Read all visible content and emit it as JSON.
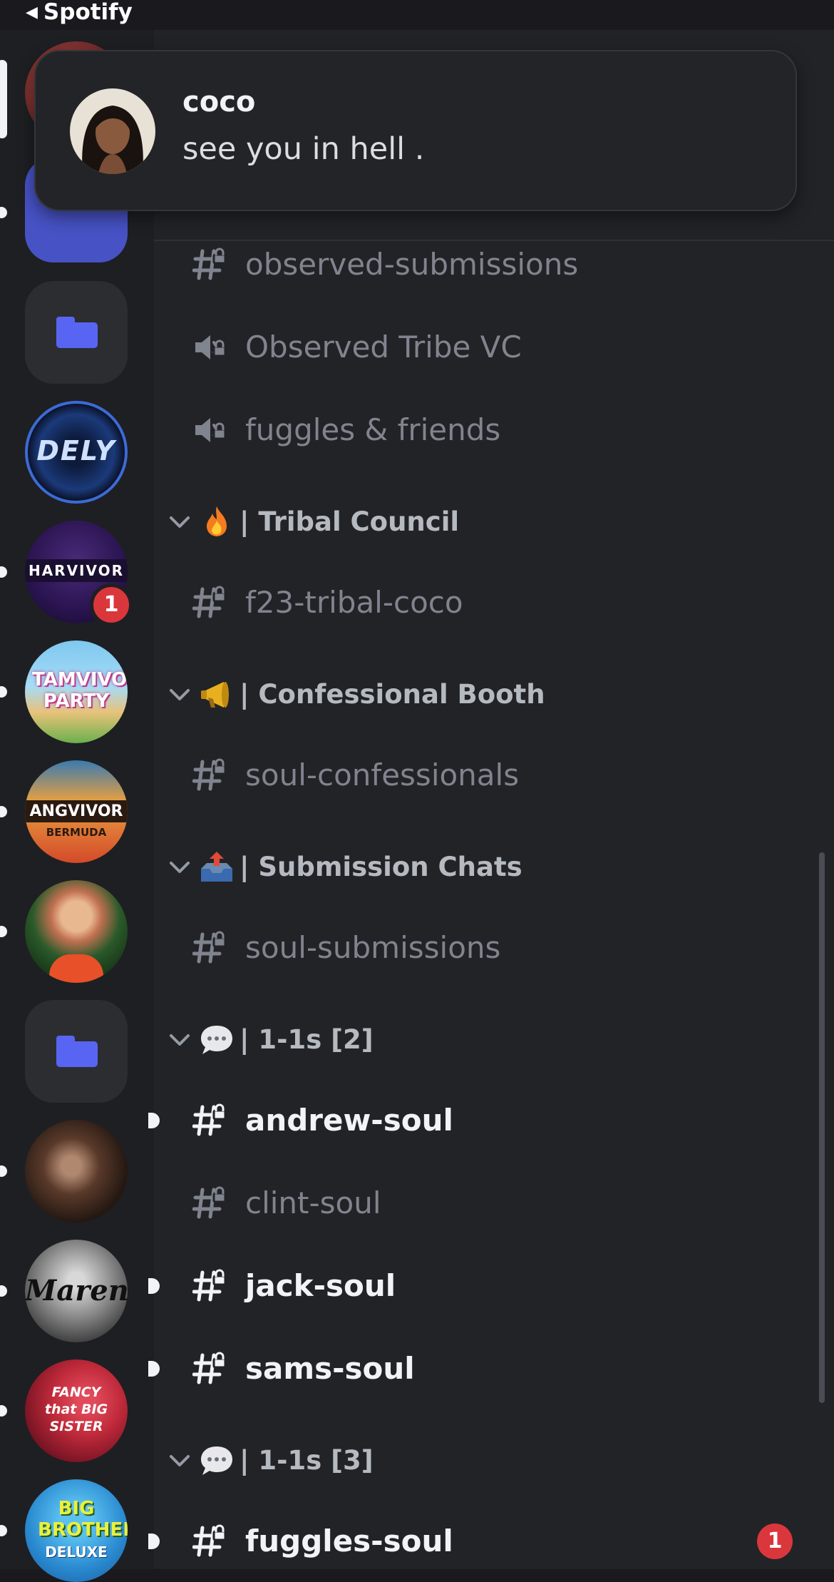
{
  "status_bar": {
    "back_label": "Spotify"
  },
  "notification": {
    "author": "coco",
    "message": "see you in hell ."
  },
  "servers": [
    {
      "label": "DELY"
    },
    {
      "label": "HARVIVOR",
      "badge": "1"
    },
    {
      "label": "TAMVIVOR PARTY"
    },
    {
      "label": "ANGVIVOR",
      "sublabel": "BERMUDA"
    },
    {
      "label": ""
    },
    {
      "label": ""
    },
    {
      "label": "Maren"
    },
    {
      "label": "FANCY that BIG SISTER"
    },
    {
      "label": "BIG BROTHER",
      "sublabel": "DELUXE"
    }
  ],
  "channels": {
    "observed_submissions": "observed-submissions",
    "observed_tribe_vc": "Observed Tribe VC",
    "fuggles_friends": "fuggles & friends",
    "tribal_council_category": "| Tribal Council",
    "f23_tribal_coco": "f23-tribal-coco",
    "confessional_category": "| Confessional Booth",
    "soul_confessionals": "soul-confessionals",
    "submission_category": "| Submission Chats",
    "soul_submissions": "soul-submissions",
    "oneonone_2_category": "| 1-1s [2]",
    "andrew_soul": "andrew-soul",
    "clint_soul": "clint-soul",
    "jack_soul": "jack-soul",
    "sams_soul": "sams-soul",
    "oneonone_3_category": "| 1-1s [3]",
    "fuggles_soul": "fuggles-soul",
    "fuggles_soul_badge": "1"
  },
  "colors": {
    "accent": "#5865f2",
    "badge": "#da373c",
    "muted_text": "#80848e",
    "unread_text": "#f2f3f5"
  }
}
